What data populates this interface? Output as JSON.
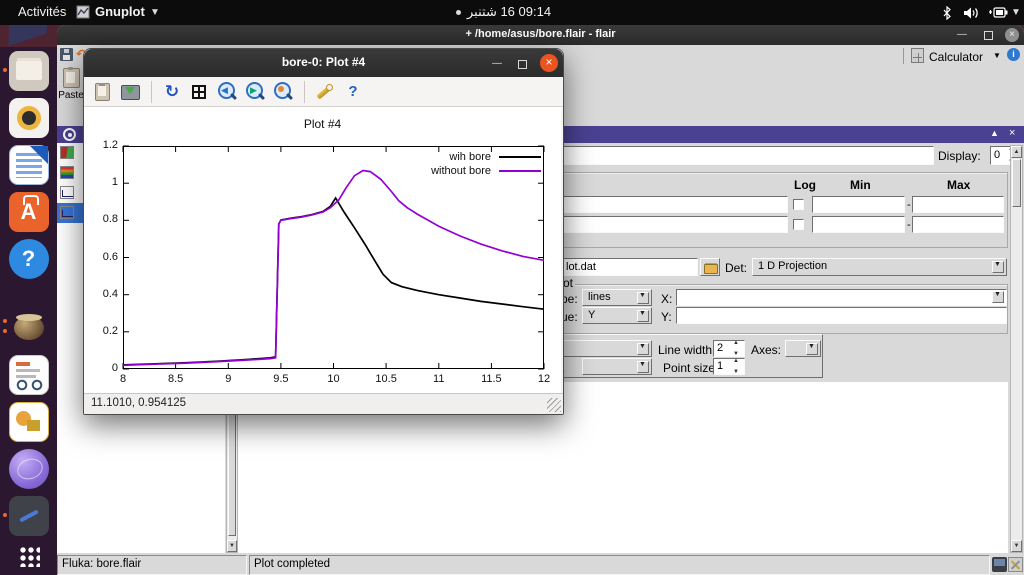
{
  "topbar": {
    "activities": "Activités",
    "app_menu": "Gnuplot",
    "clock": "09:14 16 شتنبر"
  },
  "dock": {
    "items": [
      {
        "id": "files",
        "indicators": 1
      },
      {
        "id": "rhythmbox",
        "indicators": 0
      },
      {
        "id": "libreoffice-writer",
        "indicators": 0
      },
      {
        "id": "ubuntu-software",
        "indicators": 0
      },
      {
        "id": "help",
        "indicators": 0
      },
      {
        "id": "flair",
        "indicators": 2,
        "gap": true
      },
      {
        "id": "document-viewer",
        "indicators": 0
      },
      {
        "id": "libreoffice-draw",
        "indicators": 0
      },
      {
        "id": "fluka-sphere",
        "indicators": 0
      },
      {
        "id": "notes",
        "indicators": 1
      },
      {
        "id": "show-applications",
        "indicators": 0,
        "pin_bottom": true
      }
    ]
  },
  "flair": {
    "title": "+ /home/asus/bore.flair - flair",
    "toolbar": {
      "calculator_label": "Calculator"
    },
    "paste_label": "Paste",
    "display": {
      "label": "Display:",
      "value": "0"
    },
    "limits": {
      "col_log": "Log",
      "col_min": "Min",
      "col_max": "Max",
      "dash": "-"
    },
    "file_row": {
      "value": "lot.dat",
      "det_label": "Det:",
      "det_value": "1 D Projection"
    },
    "plot_group": {
      "frame_label": "ot",
      "type_label": "pe:",
      "type_value": "lines",
      "x_label": "X:",
      "value_label": "ue:",
      "value_value": "Y",
      "y_label": "Y:"
    },
    "style_panel": {
      "line_width_label": "Line width:",
      "line_width_value": "2",
      "axes_label": "Axes:",
      "row2_label": "t",
      "point_size_label": "Point size:",
      "point_size_value": "1"
    },
    "status_left": "Fluka: bore.flair",
    "status_right": "Plot completed"
  },
  "gnuplot": {
    "title": "bore-0: Plot #4",
    "status": "11.1010, 0.954125",
    "toolbar": [
      {
        "id": "copy-icon"
      },
      {
        "id": "export-icon"
      },
      {
        "id": "separator"
      },
      {
        "id": "refresh-icon"
      },
      {
        "id": "grid-icon"
      },
      {
        "id": "zoom-previous-icon"
      },
      {
        "id": "zoom-next-icon"
      },
      {
        "id": "zoom-icon"
      },
      {
        "id": "separator"
      },
      {
        "id": "settings-icon"
      },
      {
        "id": "help-icon"
      }
    ]
  },
  "chart_data": {
    "type": "line",
    "title": "Plot #4",
    "xlabel": "",
    "ylabel": "",
    "xlim": [
      8,
      12
    ],
    "ylim": [
      0,
      1.2
    ],
    "x_ticks": [
      8,
      8.5,
      9,
      9.5,
      10,
      10.5,
      11,
      11.5,
      12
    ],
    "y_ticks": [
      0,
      0.2,
      0.4,
      0.6,
      0.8,
      1,
      1.2
    ],
    "grid": false,
    "legend_position": "top-right",
    "series": [
      {
        "name": "wih bore",
        "color": "#000000",
        "points": [
          [
            8,
            0.022
          ],
          [
            8.3,
            0.028
          ],
          [
            8.6,
            0.034
          ],
          [
            8.9,
            0.042
          ],
          [
            9.2,
            0.052
          ],
          [
            9.4,
            0.06
          ],
          [
            9.45,
            0.065
          ],
          [
            9.48,
            0.78
          ],
          [
            9.5,
            0.802
          ],
          [
            9.6,
            0.812
          ],
          [
            9.7,
            0.82
          ],
          [
            9.8,
            0.832
          ],
          [
            9.9,
            0.848
          ],
          [
            9.97,
            0.875
          ],
          [
            10.02,
            0.92
          ],
          [
            10.1,
            0.845
          ],
          [
            10.2,
            0.76
          ],
          [
            10.3,
            0.67
          ],
          [
            10.4,
            0.575
          ],
          [
            10.47,
            0.51
          ],
          [
            10.55,
            0.465
          ],
          [
            10.65,
            0.443
          ],
          [
            10.8,
            0.422
          ],
          [
            11,
            0.4
          ],
          [
            11.2,
            0.382
          ],
          [
            11.4,
            0.364
          ],
          [
            11.6,
            0.35
          ],
          [
            11.8,
            0.335
          ],
          [
            12,
            0.322
          ]
        ]
      },
      {
        "name": "without bore",
        "color": "#9400d3",
        "points": [
          [
            8,
            0.02
          ],
          [
            8.3,
            0.026
          ],
          [
            8.6,
            0.032
          ],
          [
            8.9,
            0.04
          ],
          [
            9.2,
            0.049
          ],
          [
            9.4,
            0.056
          ],
          [
            9.45,
            0.06
          ],
          [
            9.48,
            0.78
          ],
          [
            9.5,
            0.8
          ],
          [
            9.6,
            0.81
          ],
          [
            9.7,
            0.818
          ],
          [
            9.8,
            0.83
          ],
          [
            9.9,
            0.845
          ],
          [
            9.97,
            0.868
          ],
          [
            10.05,
            0.91
          ],
          [
            10.12,
            0.975
          ],
          [
            10.2,
            1.04
          ],
          [
            10.28,
            1.068
          ],
          [
            10.35,
            1.062
          ],
          [
            10.45,
            1.02
          ],
          [
            10.55,
            0.955
          ],
          [
            10.62,
            0.905
          ],
          [
            10.7,
            0.868
          ],
          [
            10.8,
            0.832
          ],
          [
            10.9,
            0.8
          ],
          [
            11,
            0.768
          ],
          [
            11.2,
            0.716
          ],
          [
            11.4,
            0.672
          ],
          [
            11.6,
            0.636
          ],
          [
            11.8,
            0.606
          ],
          [
            12,
            0.585
          ]
        ]
      }
    ]
  }
}
